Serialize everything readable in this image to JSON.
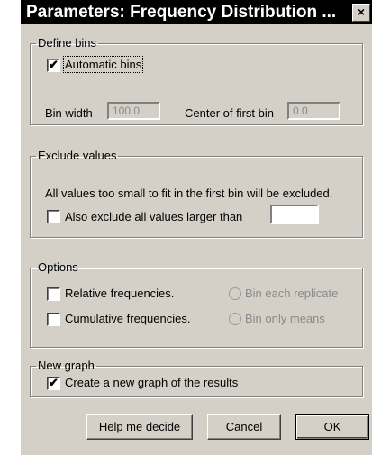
{
  "window": {
    "title": "Parameters: Frequency Distribution ...",
    "close_glyph": "×"
  },
  "define_bins": {
    "legend": "Define bins",
    "automatic_bins_label": "Automatic bins",
    "automatic_bins_checked": true,
    "bin_width_label": "Bin width",
    "bin_width_value": "100.0",
    "center_first_bin_label": "Center of first bin",
    "center_first_bin_value": "0.0"
  },
  "exclude_values": {
    "legend": "Exclude values",
    "description": "All values too small to fit in the first bin will be excluded.",
    "exclude_larger_label": "Also exclude all values larger than",
    "exclude_larger_checked": false,
    "exclude_larger_value": ""
  },
  "options": {
    "legend": "Options",
    "relative_label": "Relative frequencies.",
    "relative_checked": false,
    "cumulative_label": "Cumulative frequencies.",
    "cumulative_checked": false,
    "bin_each_label": "Bin each replicate",
    "bin_means_label": "Bin only means"
  },
  "new_graph": {
    "legend": "New graph",
    "create_graph_label": "Create a new graph of the results",
    "create_graph_checked": true
  },
  "buttons": {
    "help": "Help me decide",
    "cancel": "Cancel",
    "ok": "OK"
  },
  "check_glyph": "✔"
}
